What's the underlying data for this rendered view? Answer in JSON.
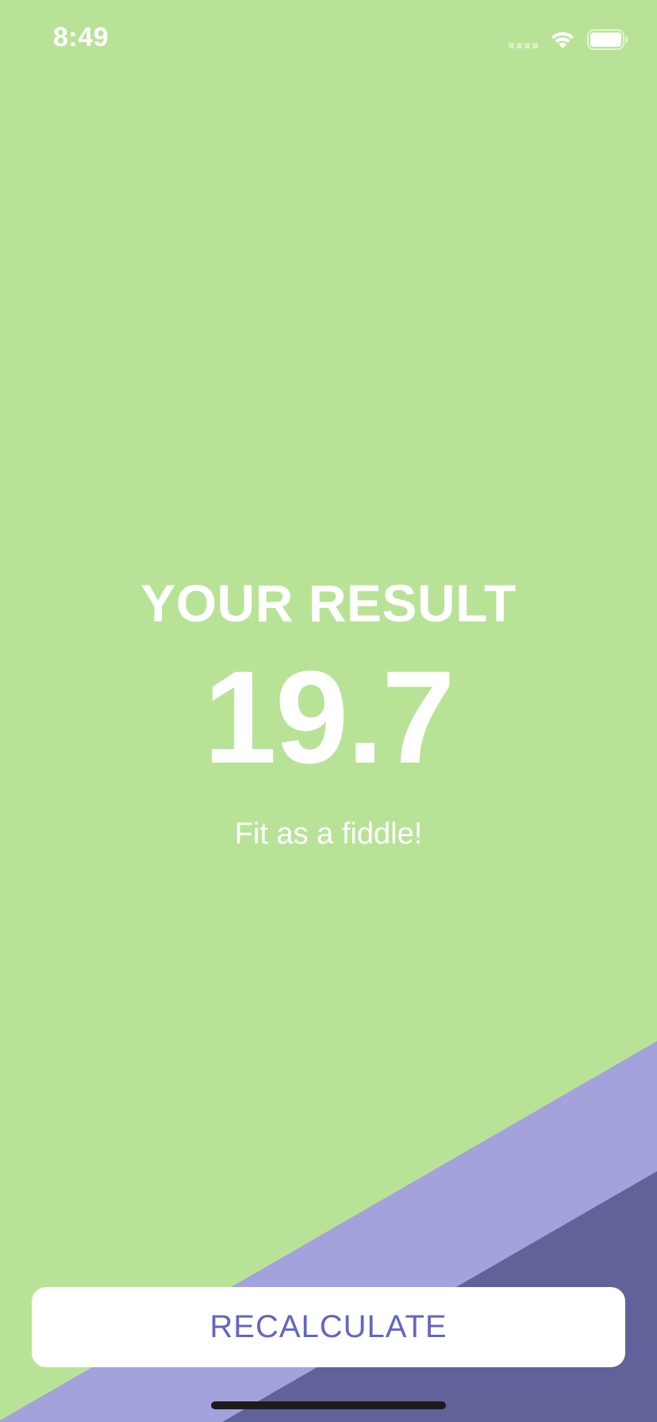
{
  "status_bar": {
    "time": "8:49"
  },
  "result": {
    "title": "YOUR RESULT",
    "value": "19.7",
    "message": "Fit as a fiddle!"
  },
  "button": {
    "label": "RECALCULATE"
  },
  "colors": {
    "background": "#b8e397",
    "stripe_light": "#a3a2dc",
    "stripe_dark": "#626199",
    "button_text": "#6266c2"
  }
}
